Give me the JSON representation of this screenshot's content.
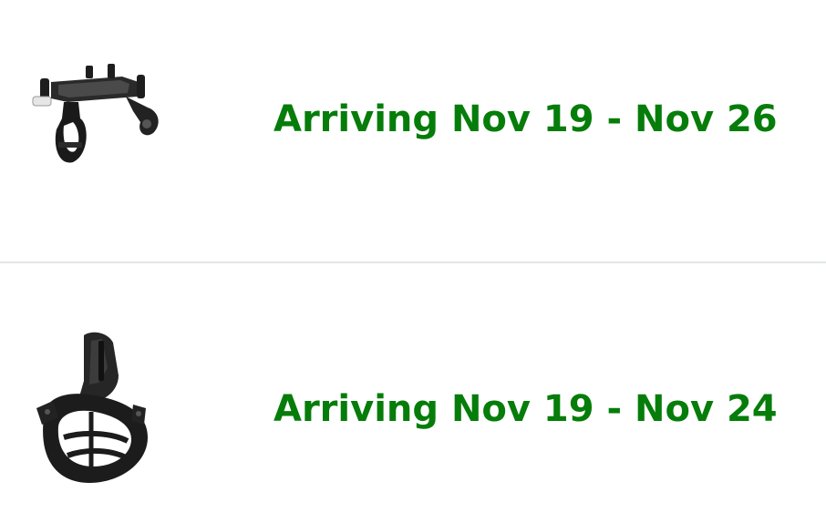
{
  "colors": {
    "delivery_text": "#067D0A",
    "divider": "#E3E6E6",
    "background": "#FFFFFF"
  },
  "orders": [
    {
      "image_icon": "phone-bike-mount-icon",
      "delivery_status": "Arriving Nov 19 - Nov 26"
    },
    {
      "image_icon": "handlebar-clamp-mount-icon",
      "delivery_status": "Arriving Nov 19 - Nov 24"
    }
  ]
}
